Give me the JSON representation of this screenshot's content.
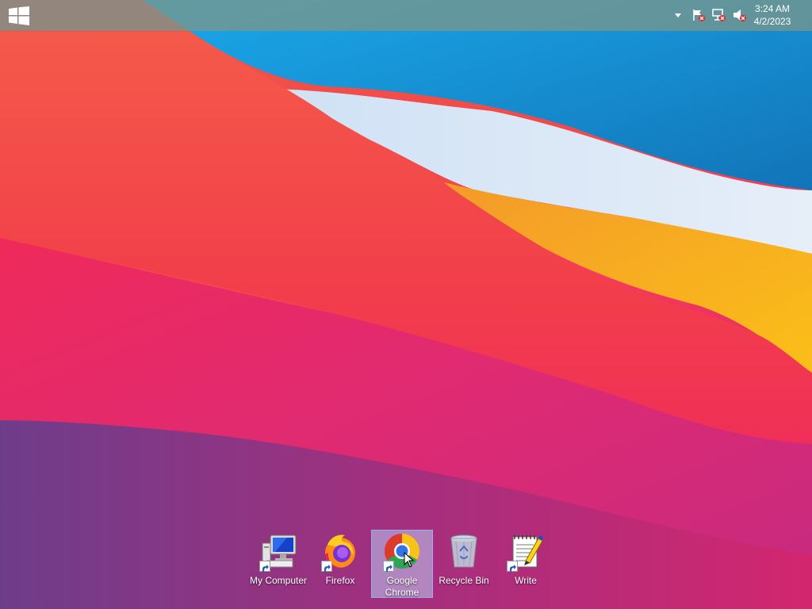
{
  "taskbar": {
    "start_icon": "windows-logo-icon",
    "tray": [
      {
        "name": "show-hidden-icons-arrow"
      },
      {
        "name": "action-center-flag-error-icon"
      },
      {
        "name": "network-disconnected-icon"
      },
      {
        "name": "speaker-muted-icon"
      }
    ],
    "clock": {
      "time": "3:24 AM",
      "date": "4/2/2023"
    }
  },
  "desktop_icons": [
    {
      "label": "My Computer",
      "icon": "computer-icon",
      "shortcut": true,
      "selected": false
    },
    {
      "label": "Firefox",
      "icon": "firefox-icon",
      "shortcut": true,
      "selected": false
    },
    {
      "label": "Google Chrome",
      "icon": "chrome-icon",
      "shortcut": true,
      "selected": true
    },
    {
      "label": "Recycle Bin",
      "icon": "recycle-bin-icon",
      "shortcut": false,
      "selected": false
    },
    {
      "label": "Write",
      "icon": "write-notepad-icon",
      "shortcut": true,
      "selected": false
    }
  ],
  "colors": {
    "taskbar": "#78968c",
    "wallpaper_red": "#f24a4a",
    "wallpaper_blue": "#1c8fd6",
    "wallpaper_yellow": "#f7b21a",
    "wallpaper_magenta": "#c82a78",
    "selection": "#becdf5"
  }
}
